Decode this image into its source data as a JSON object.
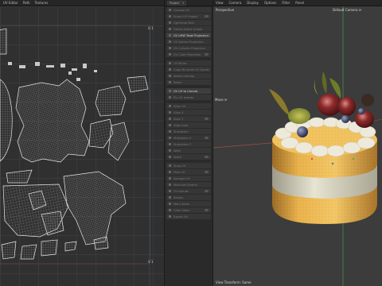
{
  "uv_editor": {
    "menu": [
      "UV Editor",
      "Path",
      "Textures"
    ],
    "tile_label_top": "U 1",
    "tile_label_bottom": "V 1"
  },
  "uv_ops": {
    "dropdown": "Project",
    "items": [
      {
        "label": "Unwrap UV",
        "bright": false
      },
      {
        "label": "Smart UV Project",
        "bright": false
      },
      {
        "label": "Lightmap Pack",
        "bright": false
      },
      {
        "label": "Follow Active Quads",
        "bright": false
      },
      {
        "label": "UV LMW Texel Projection",
        "bright": true
      },
      {
        "label": "UV Sphere Projection",
        "bright": false
      },
      {
        "label": "UV Cylinder Projection",
        "bright": false
      },
      {
        "label": "UV Cube Projection",
        "bright": false
      },
      {
        "label": "",
        "bright": false
      },
      {
        "label": "UV Mirror",
        "bright": false
      },
      {
        "label": "Copy Mirrored UV Coords",
        "bright": false
      },
      {
        "label": "Select Overlap",
        "bright": false
      },
      {
        "label": "Reset",
        "bright": false
      },
      {
        "label": "",
        "bright": false
      },
      {
        "label": "UV UV to Canvas",
        "bright": true
      },
      {
        "label": "Pin UV Islands",
        "bright": false
      },
      {
        "label": "",
        "bright": false
      },
      {
        "label": "Align UV",
        "bright": false
      },
      {
        "label": "Align X",
        "bright": false
      },
      {
        "label": "Align Y",
        "bright": false
      },
      {
        "label": "Align Auto",
        "bright": false
      },
      {
        "label": "Straighten",
        "bright": false
      },
      {
        "label": "Straighten X",
        "bright": false
      },
      {
        "label": "Straighten Y",
        "bright": false
      },
      {
        "label": "Weld",
        "bright": false
      },
      {
        "label": "Stitch",
        "bright": false
      },
      {
        "label": "",
        "bright": false
      },
      {
        "label": "Snap UV",
        "bright": false
      },
      {
        "label": "Pack UV",
        "bright": false
      },
      {
        "label": "Average UV",
        "bright": false
      },
      {
        "label": "Minimize Stretch",
        "bright": false
      },
      {
        "label": "UV Islands",
        "bright": false
      },
      {
        "label": "Seams",
        "bright": false
      },
      {
        "label": "Mark Seam",
        "bright": false
      },
      {
        "label": "Clear Seam",
        "bright": false
      },
      {
        "label": "Export UV",
        "bright": false
      }
    ]
  },
  "viewport": {
    "menu": [
      "View",
      "Camera",
      "Display",
      "Options",
      "Filter",
      "Panel"
    ],
    "perspective_label": "Perspective",
    "camera_label": "Default Camera",
    "move_label": "Move",
    "footer_label": "View Transform: Same",
    "colors": {
      "background": "#3c3c3c",
      "sponge": "#f0b84a",
      "cream": "#ece8d8",
      "axis_green": "#3f8f52",
      "axis_red": "#a24a4a"
    }
  }
}
